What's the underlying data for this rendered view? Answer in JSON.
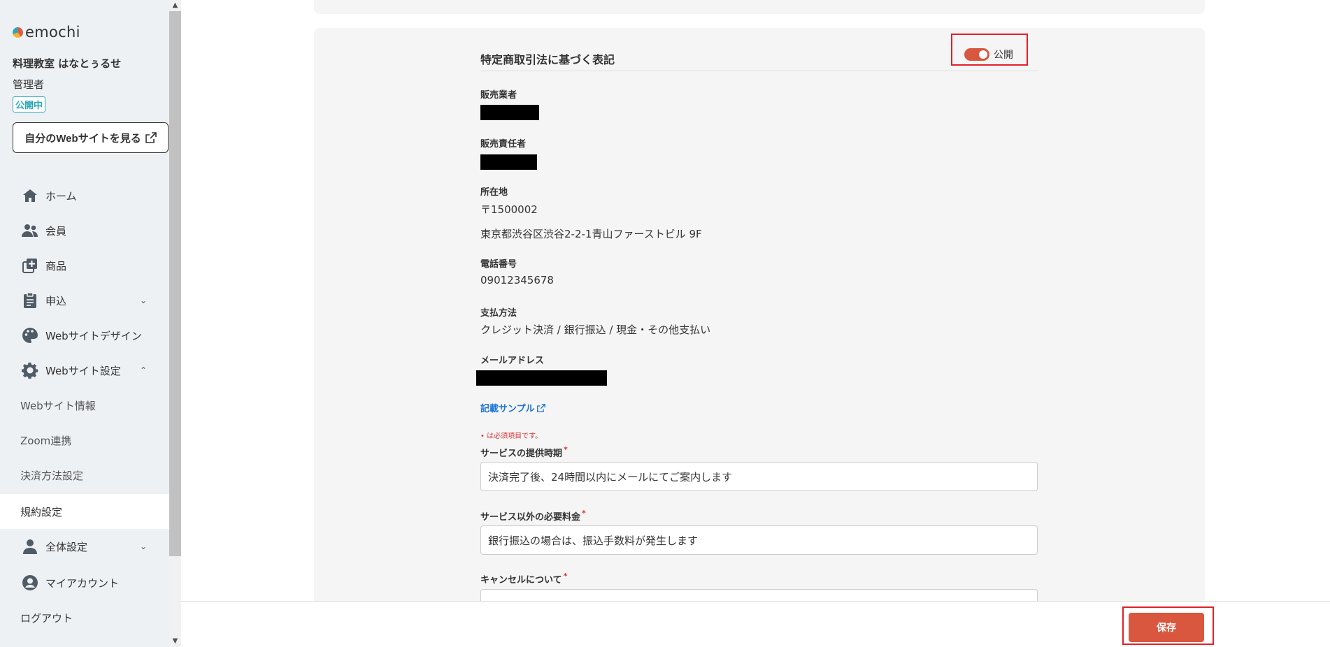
{
  "brand": {
    "name": "emochi"
  },
  "account": {
    "school_name": "料理教室 はなとぅるせ",
    "role": "管理者",
    "status": "公開中"
  },
  "view_site_button": {
    "label": "自分のWebサイトを見る"
  },
  "nav": {
    "home": "ホーム",
    "members": "会員",
    "products": "商品",
    "applications": "申込",
    "website_design": "Webサイトデザイン",
    "website_settings": "Webサイト設定",
    "sub_website_info": "Webサイト情報",
    "sub_zoom": "Zoom連携",
    "sub_payment": "決済方法設定",
    "sub_terms": "規約設定",
    "general_settings": "全体設定",
    "my_account": "マイアカウント",
    "logout": "ログアウト"
  },
  "section": {
    "title": "特定商取引法に基づく表記",
    "toggle_label": "公開",
    "toggle_on": true
  },
  "fields": {
    "seller_label": "販売業者",
    "manager_label": "販売責任者",
    "address_label": "所在地",
    "postal_code": "〒1500002",
    "address": "東京都渋谷区渋谷2-2-1青山ファーストビル 9F",
    "phone_label": "電話番号",
    "phone": "09012345678",
    "payment_label": "支払方法",
    "payment": "クレジット決済 / 銀行振込 / 現金・その他支払い",
    "email_label": "メールアドレス"
  },
  "sample_link": "記載サンプル",
  "required_note": "は必須項目です。",
  "form": {
    "delivery_label": "サービスの提供時期",
    "delivery_value": "決済完了後、24時間以内にメールにてご案内します",
    "extra_fee_label": "サービス以外の必要料金",
    "extra_fee_value": "銀行振込の場合は、振込手数料が発生します",
    "cancel_label": "キャンセルについて"
  },
  "footer": {
    "save_label": "保存"
  },
  "colors": {
    "accent": "#d9573e",
    "link": "#1a73d9",
    "status": "#2aa7b8",
    "highlight": "#e0202a"
  }
}
